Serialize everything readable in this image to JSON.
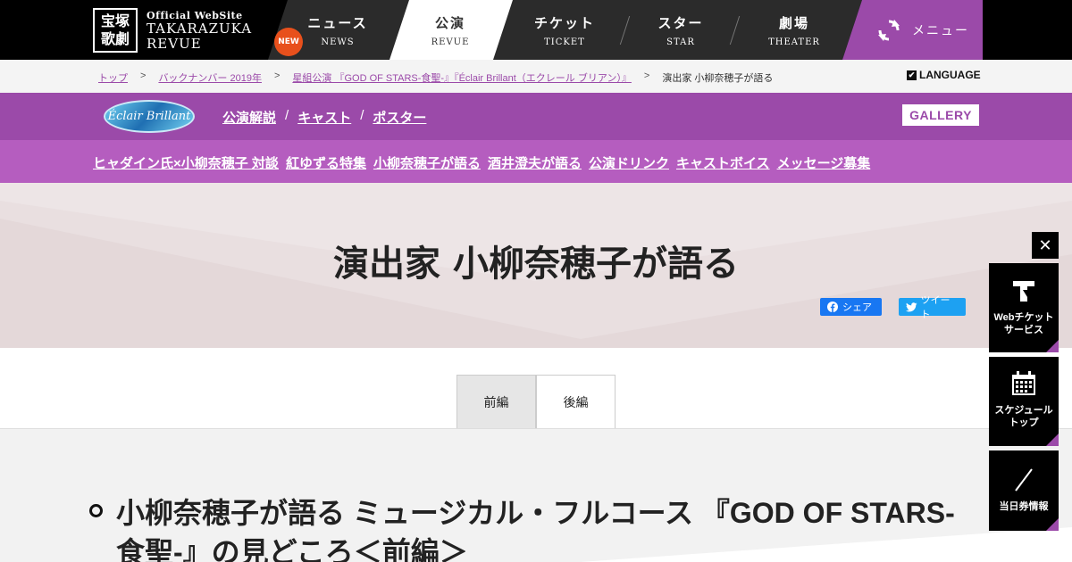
{
  "logo": {
    "seal_line1": "宝塚",
    "seal_line2": "歌劇",
    "small": "Official WebSite",
    "big": "TAKARAZUKA",
    "big2": "REVUE"
  },
  "nav": {
    "new_badge": "NEW",
    "items": [
      {
        "jp": "ニュース",
        "en": "NEWS"
      },
      {
        "jp": "公演",
        "en": "REVUE"
      },
      {
        "jp": "チケット",
        "en": "TICKET"
      },
      {
        "jp": "スター",
        "en": "STAR"
      },
      {
        "jp": "劇場",
        "en": "THEATER"
      }
    ],
    "menu_label": "メニュー"
  },
  "breadcrumb": {
    "items": [
      "トップ",
      "バックナンバー 2019年",
      "星組公演 『GOD OF STARS-食聖-』『Éclair Brillant（エクレール ブリアン）』",
      "演出家 小柳奈穂子が語る"
    ],
    "separator": ">",
    "language": "LANGUAGE",
    "language_check": "✔"
  },
  "subnav": {
    "show_logo_text": "Éclair Brillant",
    "links": [
      "公演解説",
      "キャスト",
      "ポスター"
    ],
    "slash": "/",
    "gallery": "GALLERY"
  },
  "features": [
    "ヒャダイン氏×小柳奈穂子 対談",
    "紅ゆずる特集",
    "小柳奈穂子が語る",
    "酒井澄夫が語る",
    "公演ドリンク",
    "キャストボイス",
    "メッセージ募集"
  ],
  "hero": {
    "title": "演出家 小柳奈穂子が語る",
    "share_fb": "シェア",
    "share_tw": "ツイート"
  },
  "tabs": [
    "前編",
    "後編"
  ],
  "article": {
    "heading": "小柳奈穂子が語る ミュージカル・フルコース 『GOD OF STARS-食聖-』の見どころ＜前編＞"
  },
  "side": {
    "close": "✕",
    "btn1_line1": "Webチケット",
    "btn1_line2": "サービス",
    "btn2_line1": "スケジュール",
    "btn2_line2": "トップ",
    "btn3_line1": "当日券情報"
  },
  "colors": {
    "accent": "#9b4aa9",
    "accent_light": "#b55dbf",
    "new_badge": "#e8501c",
    "facebook": "#1877f2",
    "twitter": "#1da1f2"
  }
}
